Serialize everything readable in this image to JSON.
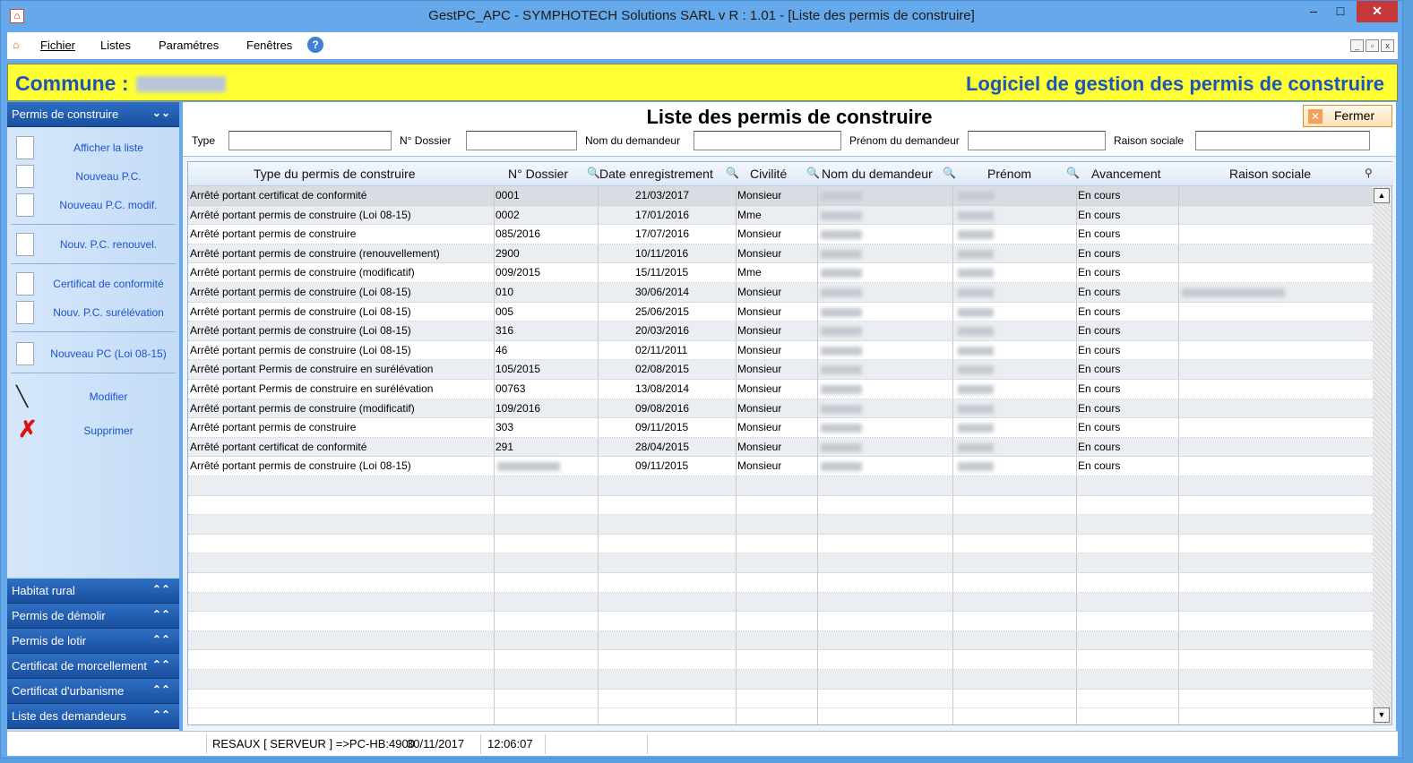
{
  "window": {
    "title": "GestPC_APC - SYMPHOTECH Solutions SARL  v R : 1.01  - [Liste des permis de construire]",
    "app_icon": "house-icon",
    "buttons": [
      "–",
      "□",
      "✕"
    ]
  },
  "menubar": {
    "items": [
      "Fichier",
      "Listes",
      "Paramétres",
      "Fenêtres"
    ],
    "help_icon": "?",
    "mdi_buttons": [
      "_",
      "▫",
      "x"
    ]
  },
  "banner": {
    "commune_label": "Commune :",
    "slogan": "Logiciel de gestion des permis de construire"
  },
  "sidebar": {
    "active_section": "Permis de construire",
    "items": [
      "Afficher la liste",
      "Nouveau P.C.",
      "Nouveau P.C. modif.",
      "Nouv. P.C. renouvel.",
      "Certificat de conformité",
      "Nouv. P.C. surélévation",
      "Nouveau PC (Loi 08-15)",
      "Modifier",
      "Supprimer"
    ],
    "sections": [
      "Habitat rural",
      "Permis de démolir",
      "Permis de lotir",
      "Certificat de morcellement",
      "Certificat d'urbanisme",
      "Liste des demandeurs"
    ]
  },
  "page": {
    "title": "Liste des permis de construire",
    "close_label": "Fermer"
  },
  "filters": {
    "type": "Type",
    "dossier": "N° Dossier",
    "nom": "Nom du demandeur",
    "prenom": "Prénom du demandeur",
    "raison": "Raison sociale"
  },
  "table": {
    "columns": [
      "Type du permis de construire",
      "N° Dossier",
      "Date enregistrement",
      "Civilité",
      "Nom du demandeur",
      "Prénom",
      "Avancement",
      "Raison sociale"
    ],
    "rows": [
      [
        "Arrêté portant certificat de conformité",
        "0001",
        "21/03/2017",
        "Monsieur",
        "En cours"
      ],
      [
        "Arrêté portant permis de construire (Loi 08-15)",
        "0002",
        "17/01/2016",
        "Mme",
        "En cours"
      ],
      [
        "Arrêté portant permis de construire",
        "085/2016",
        "17/07/2016",
        "Monsieur",
        "En cours"
      ],
      [
        "Arrêté portant permis de construire  (renouvellement)",
        "2900",
        "10/11/2016",
        "Monsieur",
        "En cours"
      ],
      [
        "Arrêté portant permis de construire  (modificatif)",
        "009/2015",
        "15/11/2015",
        "Mme",
        "En cours"
      ],
      [
        "Arrêté portant permis de construire (Loi 08-15)",
        "010",
        "30/06/2014",
        "Monsieur",
        "En cours"
      ],
      [
        "Arrêté portant permis de construire (Loi 08-15)",
        "005",
        "25/06/2015",
        "Monsieur",
        "En cours"
      ],
      [
        "Arrêté portant permis de construire (Loi 08-15)",
        "316",
        "20/03/2016",
        "Monsieur",
        "En cours"
      ],
      [
        "Arrêté portant permis de construire (Loi 08-15)",
        "46",
        "02/11/2011",
        "Monsieur",
        "En cours"
      ],
      [
        "Arrêté portant Permis de construire en surélévation",
        "105/2015",
        "02/08/2015",
        "Monsieur",
        "En cours"
      ],
      [
        "Arrêté portant Permis de construire en surélévation",
        "00763",
        "13/08/2014",
        "Monsieur",
        "En cours"
      ],
      [
        "Arrêté portant permis de construire  (modificatif)",
        "109/2016",
        "09/08/2016",
        "Monsieur",
        "En cours"
      ],
      [
        "Arrêté portant permis de construire",
        "303",
        "09/11/2015",
        "Monsieur",
        "En cours"
      ],
      [
        "Arrêté portant certificat de conformité",
        "291",
        "28/04/2015",
        "Monsieur",
        "En cours"
      ],
      [
        "Arrêté portant permis de construire (Loi 08-15)",
        "",
        "09/11/2015",
        "Monsieur",
        "En cours"
      ]
    ],
    "empty_rows": 12
  },
  "statusbar": {
    "network": "RESAUX [ SERVEUR ] =>PC-HB:4900",
    "date": "30/11/2017",
    "time": "12:06:07"
  }
}
